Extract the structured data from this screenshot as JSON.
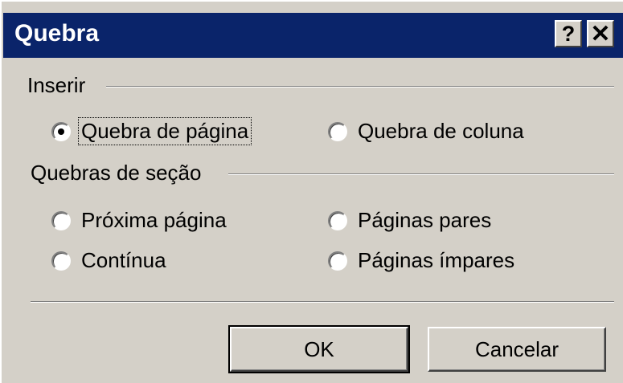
{
  "dialog": {
    "title": "Quebra",
    "help_glyph": "?",
    "close_glyph": "✕"
  },
  "insert_group": {
    "label": "Inserir",
    "options": [
      {
        "label": "Quebra de página",
        "checked": true,
        "focused": true
      },
      {
        "label": "Quebra de coluna",
        "checked": false
      }
    ]
  },
  "section_group": {
    "label": "Quebras de seção",
    "options": [
      {
        "label": "Próxima página",
        "checked": false
      },
      {
        "label": "Páginas pares",
        "checked": false
      },
      {
        "label": "Contínua",
        "checked": false
      },
      {
        "label": "Páginas ímpares",
        "checked": false
      }
    ]
  },
  "buttons": {
    "ok": "OK",
    "cancel": "Cancelar"
  },
  "colors": {
    "titlebar": "#0a246a",
    "face": "#d4d0c8"
  }
}
